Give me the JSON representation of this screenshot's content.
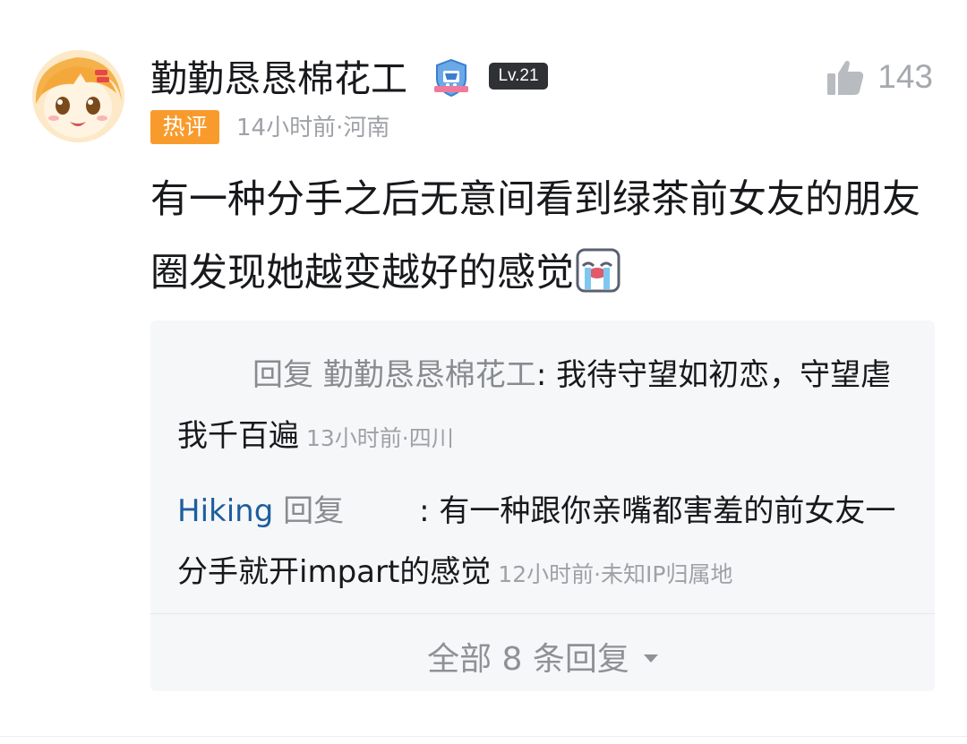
{
  "comment": {
    "username": "勤勤恳恳棉花工",
    "level": "Lv.21",
    "likes": "143",
    "hot_label": "热评",
    "meta": "14小时前·河南",
    "text": "有一种分手之后无意间看到绿茶前女友的朋友圈发现她越变越好的感觉",
    "emoji": "crying-face-emoji"
  },
  "replies": [
    {
      "prefix": "回复 勤勤恳恳棉花工",
      "text": ": 我待守望如初恋，守望虐我千百遍",
      "meta": "13小时前·四川"
    },
    {
      "user": "Hiking",
      "action": "回复",
      "text": ": 有一种跟你亲嘴都害羞的前女友一分手就开impart的感觉",
      "meta": "12小时前·未知IP归属地"
    }
  ],
  "view_all": "全部 8 条回复",
  "colors": {
    "username_link": "#1d5e9e",
    "hot_badge": "#f89b2c",
    "reply_bg": "#f6f7f9",
    "meta_gray": "#9ea1a6"
  }
}
